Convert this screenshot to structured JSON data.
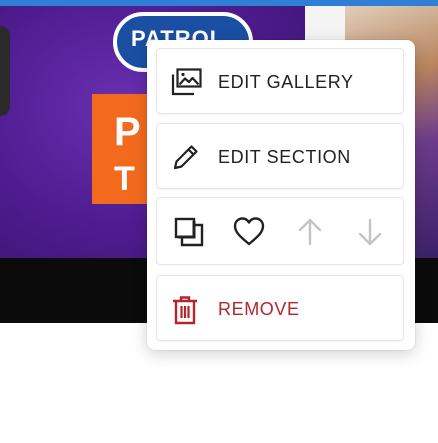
{
  "menu": {
    "edit_gallery": {
      "label": "EDIT GALLERY",
      "icon": "gallery-icon"
    },
    "edit_section": {
      "label": "EDIT SECTION",
      "icon": "pencil-icon"
    },
    "actions": [
      {
        "name": "duplicate",
        "icon": "duplicate-icon",
        "enabled": true
      },
      {
        "name": "favorite",
        "icon": "heart-icon",
        "enabled": true
      },
      {
        "name": "move-up",
        "icon": "arrow-up-icon",
        "enabled": false
      },
      {
        "name": "move-down",
        "icon": "arrow-down-icon",
        "enabled": false
      }
    ],
    "remove": {
      "label": "REMOVE",
      "icon": "trash-icon"
    }
  },
  "colors": {
    "text": "#222222",
    "danger": "#b3262c",
    "disabled": "#c4c4c4",
    "topbar": "#2f7fd6"
  }
}
